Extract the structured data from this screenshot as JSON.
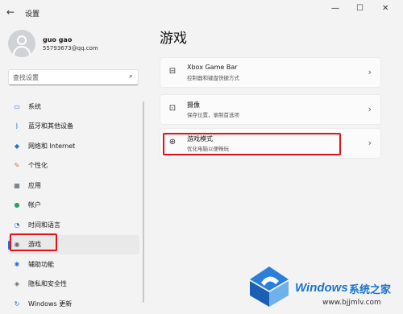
{
  "window": {
    "back_glyph": "←",
    "title": "设置",
    "minimize_glyph": "—",
    "maximize_glyph": "☐",
    "close_glyph": "✕"
  },
  "user": {
    "name": "guo gao",
    "email": "55793673@qq.com"
  },
  "search": {
    "placeholder": "查找设置"
  },
  "nav": {
    "items": [
      {
        "label": "系统",
        "icon": "monitor-icon",
        "glyph": "▭",
        "color": "#1f6fd6"
      },
      {
        "label": "蓝牙和其他设备",
        "icon": "bluetooth-icon",
        "glyph": "ᛒ",
        "color": "#1f6fd6"
      },
      {
        "label": "网络和 Internet",
        "icon": "wifi-icon",
        "glyph": "◆",
        "color": "#1f6fd6"
      },
      {
        "label": "个性化",
        "icon": "brush-icon",
        "glyph": "✎",
        "color": "#c27b1a"
      },
      {
        "label": "应用",
        "icon": "apps-icon",
        "glyph": "▦",
        "color": "#4d5a6a"
      },
      {
        "label": "帐户",
        "icon": "account-icon",
        "glyph": "●",
        "color": "#2aa06c"
      },
      {
        "label": "时间和语言",
        "icon": "globe-clock-icon",
        "glyph": "◔",
        "color": "#1f6fd6"
      },
      {
        "label": "游戏",
        "icon": "gamepad-icon",
        "glyph": "◉",
        "color": "#666"
      },
      {
        "label": "辅助功能",
        "icon": "accessibility-icon",
        "glyph": "✱",
        "color": "#1f6fd6"
      },
      {
        "label": "隐私和安全性",
        "icon": "shield-icon",
        "glyph": "◈",
        "color": "#666"
      },
      {
        "label": "Windows 更新",
        "icon": "update-icon",
        "glyph": "↻",
        "color": "#1f6fd6"
      }
    ],
    "active_index": 7
  },
  "main": {
    "title": "游戏",
    "cards": [
      {
        "title": "Xbox Game Bar",
        "subtitle": "控制器和键盘快捷方式",
        "icon": "game-bar-icon",
        "glyph": "⊟"
      },
      {
        "title": "摄像",
        "subtitle": "保存位置，录制首选项",
        "icon": "capture-icon",
        "glyph": "⊡"
      },
      {
        "title": "游戏模式",
        "subtitle": "优化电脑以便畅玩",
        "icon": "game-mode-icon",
        "glyph": "⊕"
      }
    ],
    "chevron": "›"
  },
  "watermark": {
    "brand": "Windows",
    "cn": "系统之家",
    "url": "www.bjjmlv.com"
  },
  "colors": {
    "accent": "#1f6fd6",
    "highlight": "#e0121c"
  }
}
